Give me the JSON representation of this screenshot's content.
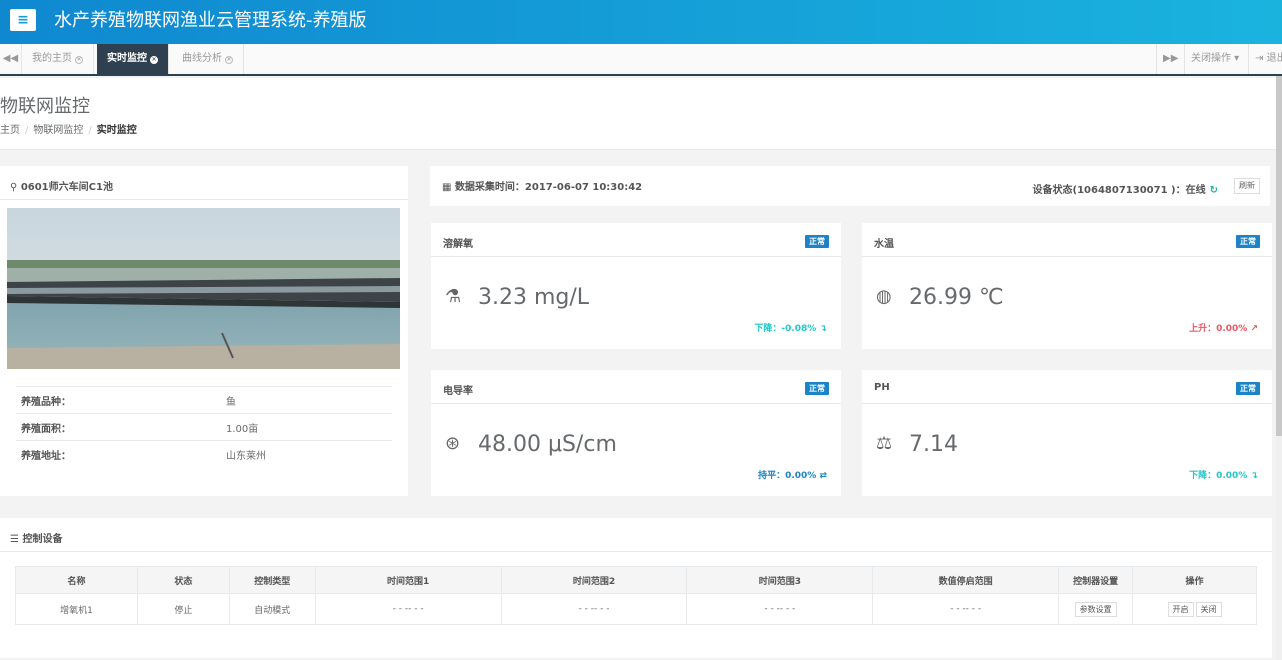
{
  "header": {
    "menu_icon": "≡",
    "title": "水产养殖物联网渔业云管理系统-养殖版"
  },
  "tabs": {
    "nav_left_icon": "◀◀",
    "items": [
      {
        "label": "我的主页"
      },
      {
        "label": "实时监控"
      },
      {
        "label": "曲线分析"
      }
    ],
    "close_icon": "✕",
    "nav_right_icon": "▶▶",
    "close_ops": "关闭操作",
    "logout": "退出"
  },
  "page": {
    "title": "物联网监控",
    "breadcrumb": [
      "主页",
      "物联网监控",
      "实时监控"
    ]
  },
  "pond": {
    "name": "0601师六车间C1池",
    "pin_icon": "⚲",
    "info": [
      {
        "label": "养殖品种：",
        "value": "鱼"
      },
      {
        "label": "养殖面积：",
        "value": "1.00亩"
      },
      {
        "label": "养殖地址：",
        "value": "山东莱州"
      }
    ]
  },
  "collect": {
    "label": "数据采集时间：2017-06-07 10:30:42",
    "status": "设备状态(1064807130071 )：在线",
    "refresh": "刷新"
  },
  "sensors": [
    {
      "name": "溶解氧",
      "status": "正常",
      "value": "3.23 mg/L",
      "icon": "flask-icon",
      "trend": "下降：-0.08%",
      "trend_arrow": "↴"
    },
    {
      "name": "水温",
      "status": "正常",
      "value": "26.99 ℃",
      "icon": "thermometer-icon",
      "trend": "上升：0.00%",
      "trend_arrow": "↗"
    },
    {
      "name": "电导率",
      "status": "正常",
      "value": "48.00 μS/cm",
      "icon": "pulse-icon",
      "trend": "持平：0.00%",
      "trend_arrow": "⇄"
    },
    {
      "name": "PH",
      "status": "正常",
      "value": "7.14",
      "icon": "balance-icon",
      "trend": "下降：0.00%",
      "trend_arrow": "↴"
    }
  ],
  "control": {
    "title": "控制设备",
    "columns": [
      "名称",
      "状态",
      "控制类型",
      "时间范围1",
      "时间范围2",
      "时间范围3",
      "数值停启范围",
      "控制器设置",
      "操作"
    ],
    "rows": [
      {
        "name": "增氧机1",
        "state": "停止",
        "type": "自动模式",
        "range1": "- - -- - -",
        "range2": "- - -- - -",
        "range3": "- - -- - -",
        "value_range": "- - -- - -",
        "settings": "参数设置",
        "open": "开启",
        "close": "关闭"
      }
    ]
  },
  "colors": {
    "header_start": "#0f88d0",
    "header_end": "#1ab3de",
    "badge": "#1c84c6",
    "down": "#23c6c8",
    "up": "#ed5565"
  }
}
